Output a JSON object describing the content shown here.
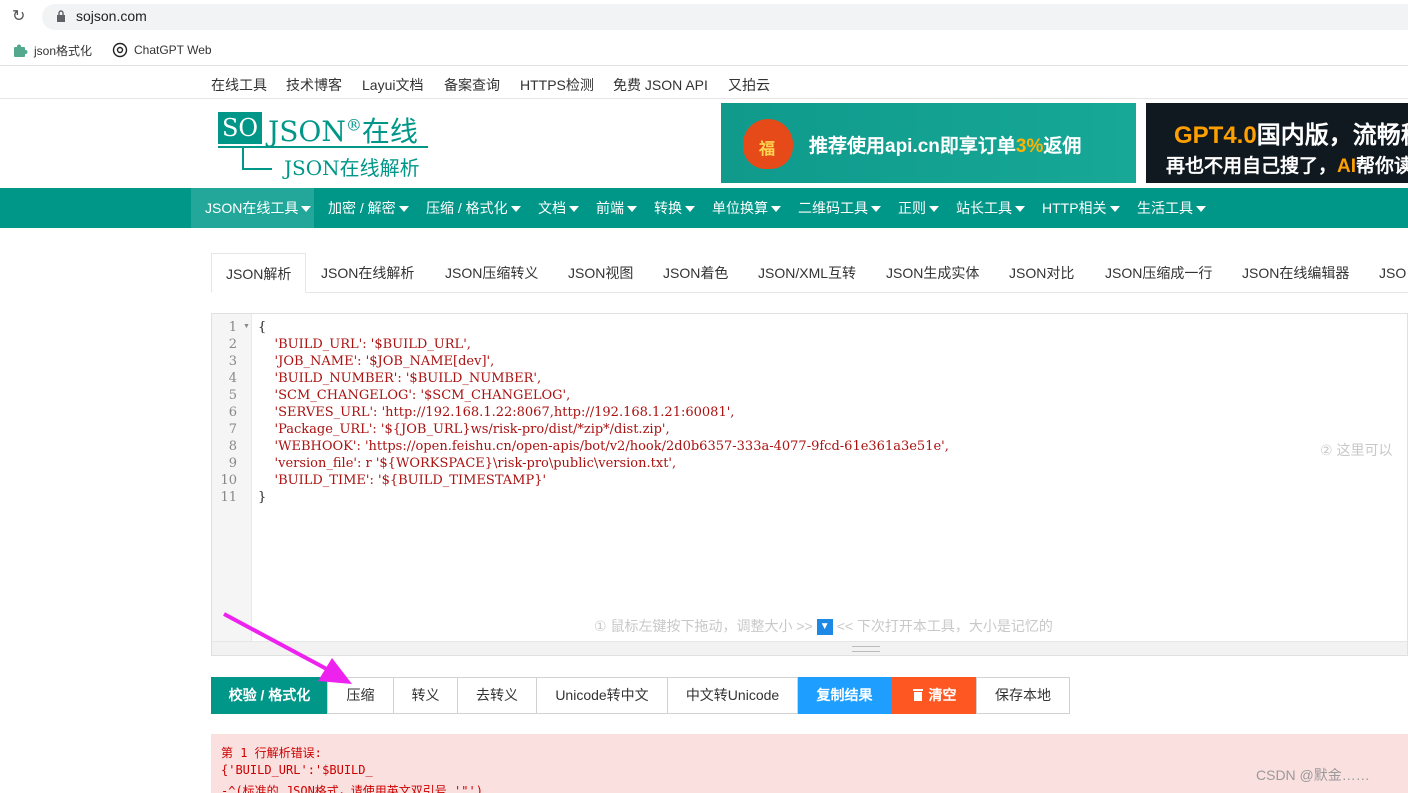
{
  "browser": {
    "url": "sojson.com"
  },
  "bookmarks": [
    {
      "label": "json格式化"
    },
    {
      "label": "ChatGPT Web"
    }
  ],
  "top_links": [
    "在线工具",
    "技术博客",
    "Layui文档",
    "备案查询",
    "HTTPS检测",
    "免费 JSON API",
    "又拍云"
  ],
  "logo": {
    "box": "SO",
    "main": "JSON",
    "mark": "®",
    "suffix": "在线",
    "sub": "JSON在线解析"
  },
  "ads": {
    "ad1": {
      "badge": "福",
      "text_a": "推荐使用api.cn即享订单",
      "text_hl": "3%",
      "text_b": "返佣"
    },
    "ad2": {
      "l1_hl": "GPT4.0",
      "l1": "国内版，流畅稳",
      "l2_a": "再也不用自己搜了，",
      "l2_hl": "AI",
      "l2_b": "帮你读"
    }
  },
  "nav": [
    "JSON在线工具",
    "加密 / 解密",
    "压缩 / 格式化",
    "文档",
    "前端",
    "转换",
    "单位换算",
    "二维码工具",
    "正则",
    "站长工具",
    "HTTP相关",
    "生活工具"
  ],
  "tabs": [
    "JSON解析",
    "JSON在线解析",
    "JSON压缩转义",
    "JSON视图",
    "JSON着色",
    "JSON/XML互转",
    "JSON生成实体",
    "JSON对比",
    "JSON压缩成一行",
    "JSON在线编辑器",
    "JSO"
  ],
  "editor": {
    "line_numbers": [
      "1",
      "2",
      "3",
      "4",
      "5",
      "6",
      "7",
      "8",
      "9",
      "10",
      "11"
    ],
    "lines": [
      "{",
      "    'BUILD_URL': '$BUILD_URL',",
      "    'JOB_NAME': '$JOB_NAME[dev]',",
      "    'BUILD_NUMBER': '$BUILD_NUMBER',",
      "    'SCM_CHANGELOG': '$SCM_CHANGELOG',",
      "    'SERVES_URL': 'http://192.168.1.22:8067,http://192.168.1.21:60081',",
      "    'Package_URL': '${JOB_URL}ws/risk-pro/dist/*zip*/dist.zip',",
      "    'WEBHOOK': 'https://open.feishu.cn/open-apis/bot/v2/hook/2d0b6357-333a-4077-9fcd-61e361a3e51e',",
      "    'version_file': r '${WORKSPACE}\\risk-pro\\public\\version.txt',",
      "    'BUILD_TIME': '${BUILD_TIMESTAMP}'",
      "}"
    ],
    "hint_resize_a": "① 鼠标左键按下拖动，调整大小 >>",
    "hint_resize_b": "<< 下次打开本工具，大小是记忆的",
    "hint_right": "② 这里可以"
  },
  "buttons": [
    "校验 / 格式化",
    "压缩",
    "转义",
    "去转义",
    "Unicode转中文",
    "中文转Unicode",
    "复制结果",
    "清空",
    "保存本地"
  ],
  "error": {
    "line1": "第 1 行解析错误:",
    "line2": "{'BUILD_URL':'$BUILD_",
    "line3": "-^(标准的 JSON格式，请使用英文双引号 '\"')"
  },
  "watermark": "CSDN @默金……",
  "colors": {
    "primary": "#009688",
    "blue": "#1e9fff",
    "orange": "#ff5722",
    "annotation_arrow": "#ee22ee"
  }
}
